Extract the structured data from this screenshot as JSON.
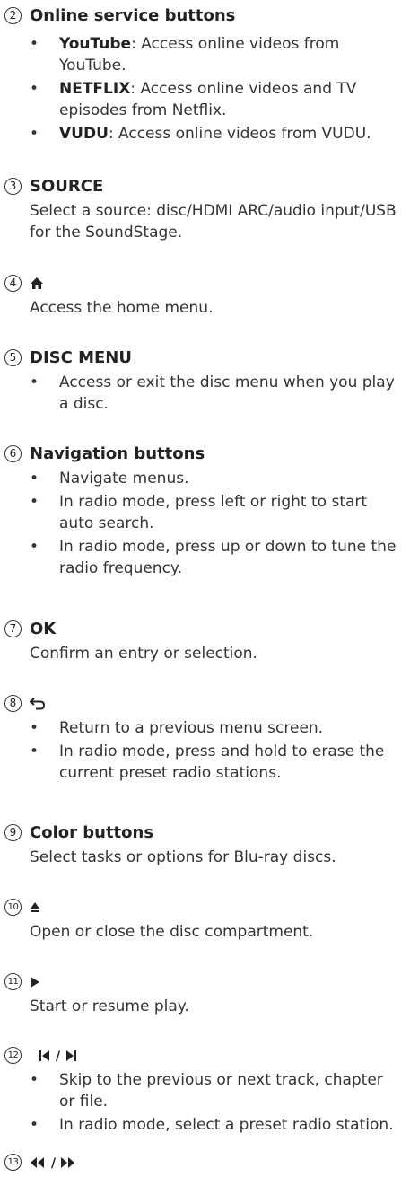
{
  "items": [
    {
      "num": "2",
      "heading": "Online service buttons",
      "bullets": [
        {
          "bold": "YouTube",
          "text": ": Access online videos from YouTube."
        },
        {
          "bold": "NETFLIX",
          "text": ": Access online videos and TV episodes from Netflix."
        },
        {
          "bold": "VUDU",
          "text": ": Access online videos from VUDU."
        }
      ]
    },
    {
      "num": "3",
      "heading": "SOURCE",
      "desc": "Select a source: disc/HDMI ARC/audio input/USB for the SoundStage."
    },
    {
      "num": "4",
      "heading": "⌂",
      "desc": "Access the home menu."
    },
    {
      "num": "5",
      "heading": "DISC MENU",
      "bullets": [
        {
          "text": "Access or exit the disc menu when you play a disc."
        }
      ]
    },
    {
      "num": "6",
      "heading": "Navigation buttons",
      "bullets": [
        {
          "text": "Navigate menus."
        },
        {
          "text": "In radio mode, press left or right to start auto search."
        },
        {
          "text": "In radio mode, press up or down to tune the radio frequency."
        }
      ]
    },
    {
      "num": "7",
      "heading": "OK",
      "desc": "Confirm an entry or selection."
    },
    {
      "num": "8",
      "heading": "⮌",
      "bullets": [
        {
          "text": "Return to a previous menu screen."
        },
        {
          "text": "In radio mode, press and hold to erase the current preset radio stations."
        }
      ]
    },
    {
      "num": "9",
      "heading": "Color buttons",
      "desc": "Select tasks or options for Blu-ray discs."
    },
    {
      "num": "10",
      "heading": "⏏",
      "desc": "Open or close the disc compartment."
    },
    {
      "num": "11",
      "heading": "▶",
      "desc": "Start or resume play."
    },
    {
      "num": "12",
      "heading": "⏮ / ⏭",
      "bullets": [
        {
          "text": "Skip to the previous or next track, chapter or file."
        },
        {
          "text": "In radio mode, select a preset radio station."
        }
      ]
    },
    {
      "num": "13",
      "heading": "⏪ / ⏩"
    }
  ]
}
